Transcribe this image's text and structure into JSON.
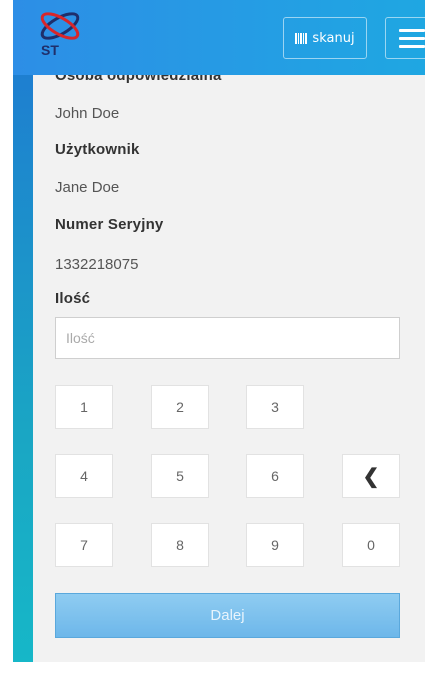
{
  "header": {
    "logo_text": "ST",
    "scan_label": "skanuj",
    "scan_icon": "barcode-icon",
    "menu_icon": "hamburger-icon"
  },
  "fields": {
    "responsible_label": "Osoba odpowiedzialna",
    "responsible_value": "John Doe",
    "user_label": "Użytkownik",
    "user_value": "Jane Doe",
    "serial_label": "Numer Seryjny",
    "serial_value": "1332218075",
    "quantity_label": "Ilość",
    "quantity_placeholder": "Ilość",
    "quantity_value": ""
  },
  "keypad": {
    "keys": [
      "1",
      "2",
      "3",
      "4",
      "5",
      "6",
      "7",
      "8",
      "9",
      "0"
    ],
    "backspace_symbol": "❮"
  },
  "actions": {
    "next_label": "Dalej"
  },
  "colors": {
    "header_gradient_start": "#2d8ee6",
    "header_gradient_end": "#1fa7e2",
    "panel_background": "#f2f2f2",
    "next_button": "#7fc2ee",
    "logo_red": "#d8262a",
    "logo_navy": "#1f2f6b"
  }
}
